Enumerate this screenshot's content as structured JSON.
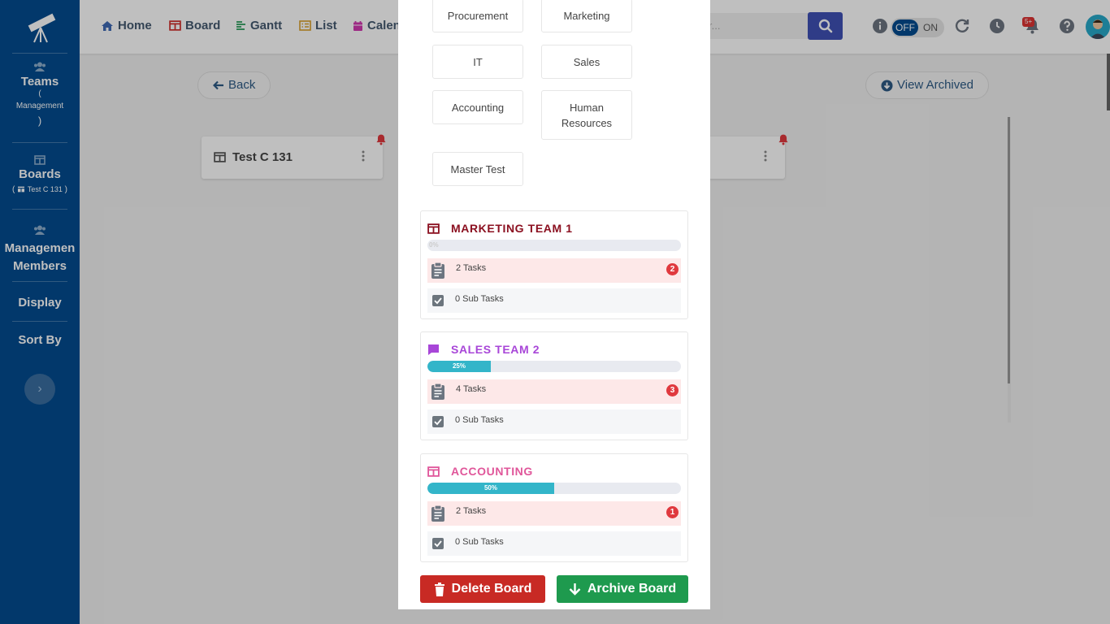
{
  "sidebar": {
    "teams_title": "Teams",
    "teams_paren_open": "(",
    "teams_sub": "Management",
    "teams_paren_close": ")",
    "boards_title": "Boards",
    "boards_sub": "Test C 131",
    "members_title_1": "Managemen",
    "members_title_2": "Members",
    "display": "Display",
    "sort_by": "Sort By"
  },
  "nav": {
    "home": "Home",
    "board": "Board",
    "gantt": "Gantt",
    "list": "List",
    "calendar": "Calen"
  },
  "search": {
    "placeholder": "r..."
  },
  "toggle": {
    "off": "OFF",
    "on": "ON"
  },
  "notifications": {
    "badge": "5+"
  },
  "main": {
    "back": "Back",
    "view_archived": "View Archived",
    "board_card_title": "Test C 131"
  },
  "modal": {
    "departments": [
      "Procurement",
      "Marketing",
      "IT",
      "Sales",
      "Accounting",
      "Human Resources",
      "Master Test"
    ],
    "teams": [
      {
        "name": "MARKETING TEAM 1",
        "color": "#8b1020",
        "icon": "board-icon",
        "progress": 0,
        "progress_label": "0%",
        "tasks": "2 Tasks",
        "task_count": "2",
        "sub_tasks": "0 Sub Tasks"
      },
      {
        "name": "SALES TEAM 2",
        "color": "#a846d8",
        "icon": "comment-icon",
        "progress": 25,
        "progress_label": "25%",
        "tasks": "4 Tasks",
        "task_count": "3",
        "sub_tasks": "0 Sub Tasks"
      },
      {
        "name": "ACCOUNTING",
        "color": "#e0569a",
        "icon": "board-icon",
        "progress": 50,
        "progress_label": "50%",
        "tasks": "2 Tasks",
        "task_count": "1",
        "sub_tasks": "0 Sub Tasks"
      }
    ],
    "delete_label": "Delete Board",
    "archive_label": "Archive Board"
  }
}
